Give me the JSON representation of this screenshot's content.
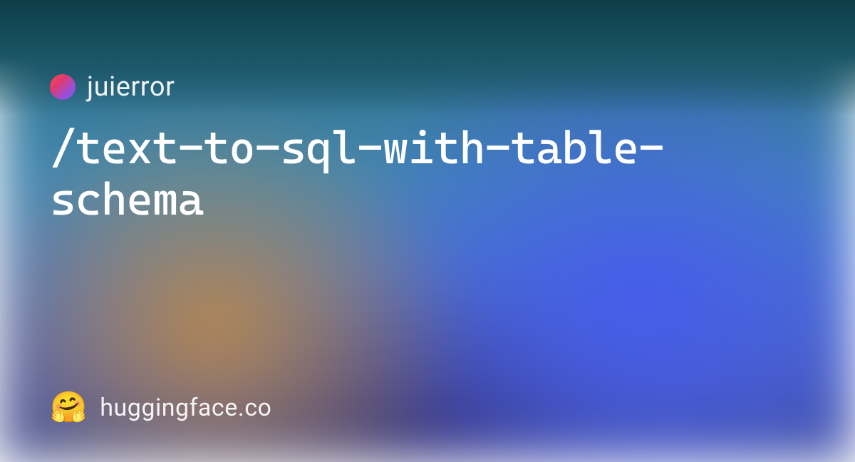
{
  "author": {
    "name": "juierror"
  },
  "model": {
    "name": "/text-to-sql-with-table-schema"
  },
  "footer": {
    "emoji": "🤗",
    "site": "huggingface.co"
  }
}
